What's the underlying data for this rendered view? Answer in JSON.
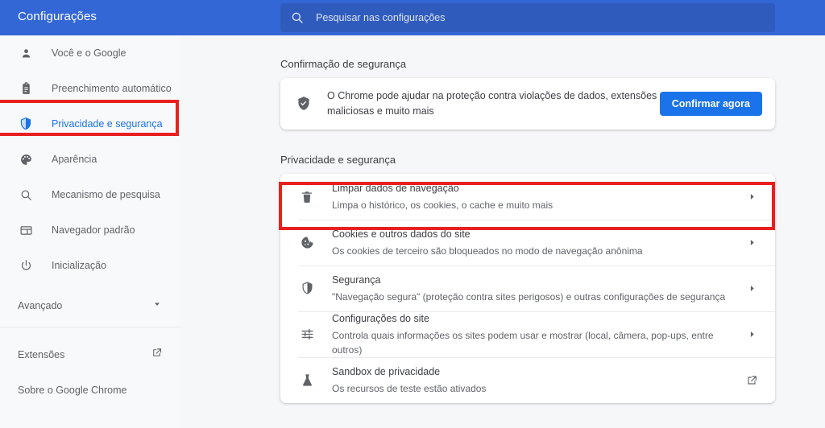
{
  "header": {
    "title": "Configurações",
    "search": {
      "placeholder": "Pesquisar nas configurações",
      "icon": "search-icon"
    },
    "background_color": "#3367d6"
  },
  "sidebar": {
    "items": [
      {
        "label": "Você e o Google",
        "icon": "person-icon",
        "active": false
      },
      {
        "label": "Preenchimento automático",
        "icon": "clipboard-icon",
        "active": false
      },
      {
        "label": "Privacidade e segurança",
        "icon": "shield-icon",
        "active": true
      },
      {
        "label": "Aparência",
        "icon": "palette-icon",
        "active": false
      },
      {
        "label": "Mecanismo de pesquisa",
        "icon": "search-icon",
        "active": false
      },
      {
        "label": "Navegador padrão",
        "icon": "browser-window-icon",
        "active": false
      },
      {
        "label": "Inicialização",
        "icon": "power-icon",
        "active": false
      }
    ],
    "advanced": {
      "label": "Avançado",
      "icon": "chevron-down-icon"
    },
    "bottom_links": [
      {
        "label": "Extensões",
        "icon": "open-in-new-icon"
      },
      {
        "label": "Sobre o Google Chrome",
        "icon": ""
      }
    ],
    "active_color": "#1a73e8"
  },
  "main": {
    "safety_check": {
      "section_title": "Confirmação de segurança",
      "icon": "shield-check-icon",
      "description": "O Chrome pode ajudar na proteção contra violações de dados, extensões maliciosas e muito mais",
      "button_label": "Confirmar agora",
      "button_color": "#1a73e8"
    },
    "privacy": {
      "section_title": "Privacidade e segurança",
      "rows": [
        {
          "title": "Limpar dados de navegação",
          "subtitle": "Limpa o histórico, os cookies, o cache e muito mais",
          "icon": "trash-icon",
          "end_icon": "chevron-right-icon",
          "highlighted": true
        },
        {
          "title": "Cookies e outros dados do site",
          "subtitle": "Os cookies de terceiro são bloqueados no modo de navegação anônima",
          "icon": "cookie-icon",
          "end_icon": "chevron-right-icon",
          "highlighted": false
        },
        {
          "title": "Segurança",
          "subtitle": "\"Navegação segura\" (proteção contra sites perigosos) e outras configurações de segurança",
          "icon": "shield-icon",
          "end_icon": "chevron-right-icon",
          "highlighted": false
        },
        {
          "title": "Configurações do site",
          "subtitle": "Controla quais informações os sites podem usar e mostrar (local, câmera, pop-ups, entre outros)",
          "icon": "tune-icon",
          "end_icon": "chevron-right-icon",
          "highlighted": false
        },
        {
          "title": "Sandbox de privacidade",
          "subtitle": "Os recursos de teste estão ativados",
          "icon": "flask-icon",
          "end_icon": "open-in-new-icon",
          "highlighted": false
        }
      ]
    }
  },
  "annotations": {
    "highlight_color": "#e8201e",
    "boxes": [
      {
        "target": "sidebar-item-privacidade-e-seguranca"
      },
      {
        "target": "privacy-row-limpar-dados-de-navegacao"
      }
    ]
  }
}
